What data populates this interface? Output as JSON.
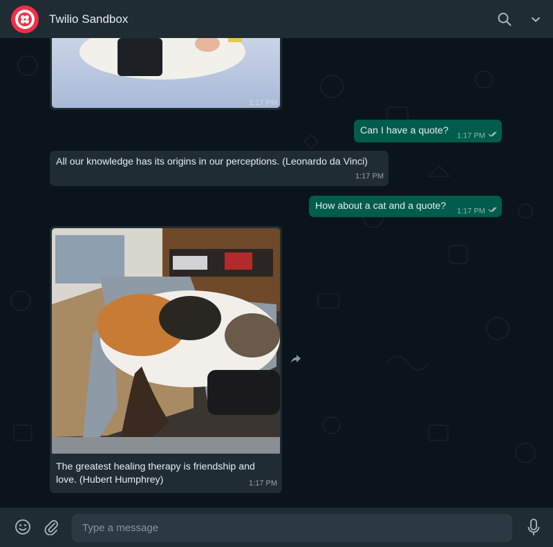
{
  "header": {
    "title": "Twilio Sandbox",
    "icons": [
      "twilio-logo",
      "search-icon",
      "chevron-down-icon"
    ]
  },
  "messages": [
    {
      "direction": "in",
      "type": "image",
      "time": "1:17 PM"
    },
    {
      "direction": "out",
      "type": "text",
      "text": "Can I have a quote?",
      "time": "1:17 PM",
      "status": "read"
    },
    {
      "direction": "in",
      "type": "text",
      "text": "All our knowledge has its origins in our perceptions. (Leonardo da Vinci)",
      "time": "1:17 PM"
    },
    {
      "direction": "out",
      "type": "text",
      "text": "How about a cat and a quote?",
      "time": "1:17 PM",
      "status": "read"
    },
    {
      "direction": "in",
      "type": "image",
      "caption": "The greatest healing therapy is friendship and love. (Hubert Humphrey)",
      "time": "1:17 PM"
    }
  ],
  "composer": {
    "placeholder": "Type a message",
    "icons": [
      "emoji-icon",
      "attach-icon",
      "microphone-icon"
    ]
  },
  "colors": {
    "header_bg": "#202c33",
    "chat_bg": "#0b141a",
    "incoming_bubble": "#202c33",
    "outgoing_bubble": "#005c4b",
    "twilio_red": "#f22f46",
    "read_tick": "#53bdeb"
  }
}
